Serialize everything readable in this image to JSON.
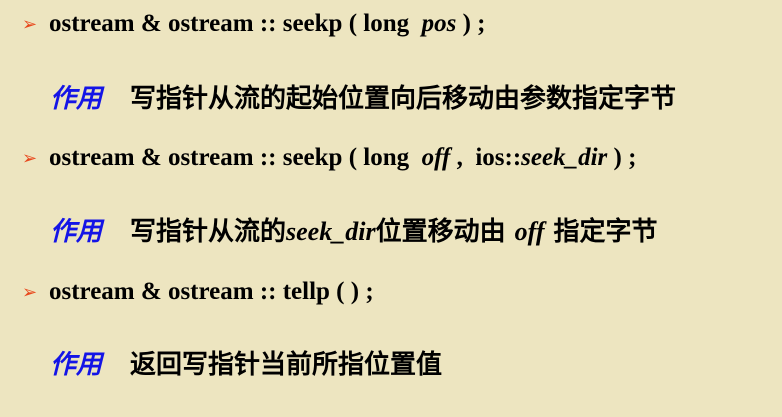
{
  "bullet_glyph": "➢",
  "items": [
    {
      "code": {
        "prefix": "ostream & ostream :: seekp ( long  ",
        "arg_italic": "pos",
        "suffix": " ) ;"
      },
      "desc": {
        "label": "作用",
        "text_before": "写指针从流的起始位置向后移动由参数指定字节",
        "italic": "",
        "text_mid": "",
        "italic2": "",
        "text_after": ""
      }
    },
    {
      "code": {
        "prefix": "ostream & ostream :: seekp ( long  ",
        "arg_italic": "off",
        "mid": " ,  ios::",
        "arg_italic2": "seek_dir",
        "suffix": " ) ;"
      },
      "desc": {
        "label": "作用",
        "text_before": "写指针从流的",
        "italic": "seek_dir",
        "text_mid": "位置移动由 ",
        "italic2": "off",
        "text_after": " 指定字节"
      }
    },
    {
      "code": {
        "prefix": "ostream & ostream :: tellp ( ) ;"
      },
      "desc": {
        "label": "作用",
        "text_before": "返回写指针当前所指位置值"
      }
    }
  ]
}
